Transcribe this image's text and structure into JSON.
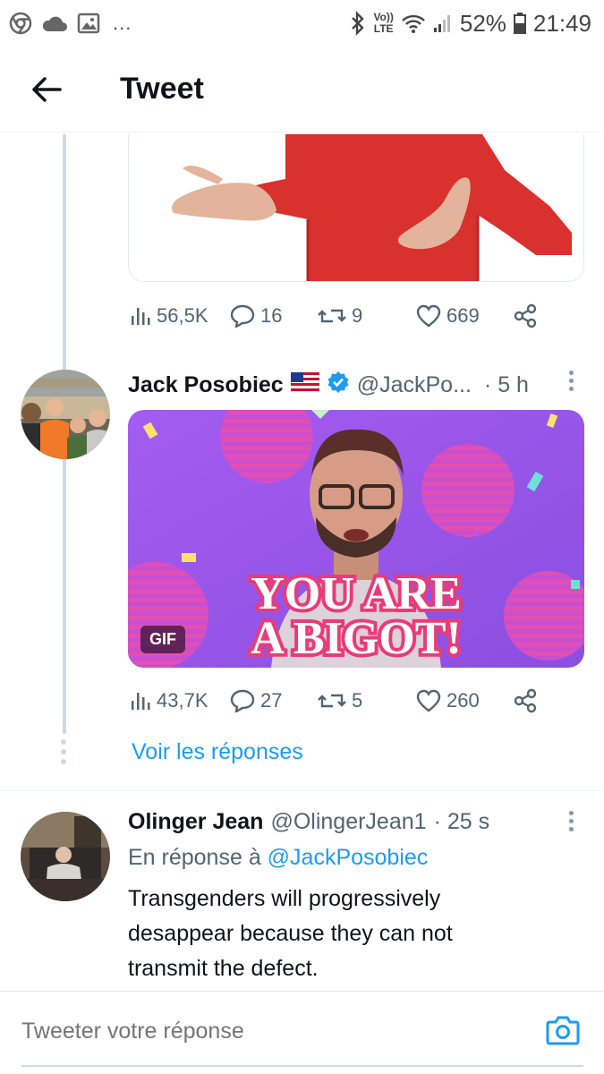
{
  "status_bar": {
    "icons_left": [
      "chrome-icon",
      "cloud-icon",
      "image-icon"
    ],
    "overflow": "...",
    "network": "Vo))\nLTE",
    "battery": "52%",
    "time": "21:49"
  },
  "header": {
    "title": "Tweet"
  },
  "tweet1": {
    "metrics": {
      "views": "56,5K",
      "replies": "16",
      "retweets": "9",
      "likes": "669"
    }
  },
  "tweet2": {
    "name": "Jack Posobiec",
    "flag": "us-flag-icon",
    "verified": true,
    "handle": "@JackPo...",
    "time": "· 5 h",
    "gif_text_line1": "YOU ARE",
    "gif_text_line2": "A BIGOT!",
    "gif_badge": "GIF",
    "metrics": {
      "views": "43,7K",
      "replies": "27",
      "retweets": "5",
      "likes": "260"
    }
  },
  "voir_reponses": "Voir les réponses",
  "tweet3": {
    "name": "Olinger Jean",
    "handle": "@OlingerJean1",
    "time": "· 25 s",
    "reply_prefix": "En réponse à",
    "reply_to": "@JackPosobiec",
    "text_line1": "Transgenders will progressively",
    "text_line2": "desappear because they can not",
    "text_line3": "transmit the defect."
  },
  "compose": {
    "placeholder": "Tweeter votre réponse"
  },
  "colors": {
    "accent": "#1d9bf0",
    "secondary_text": "#536471",
    "gif_purple": "#9b5de5"
  }
}
